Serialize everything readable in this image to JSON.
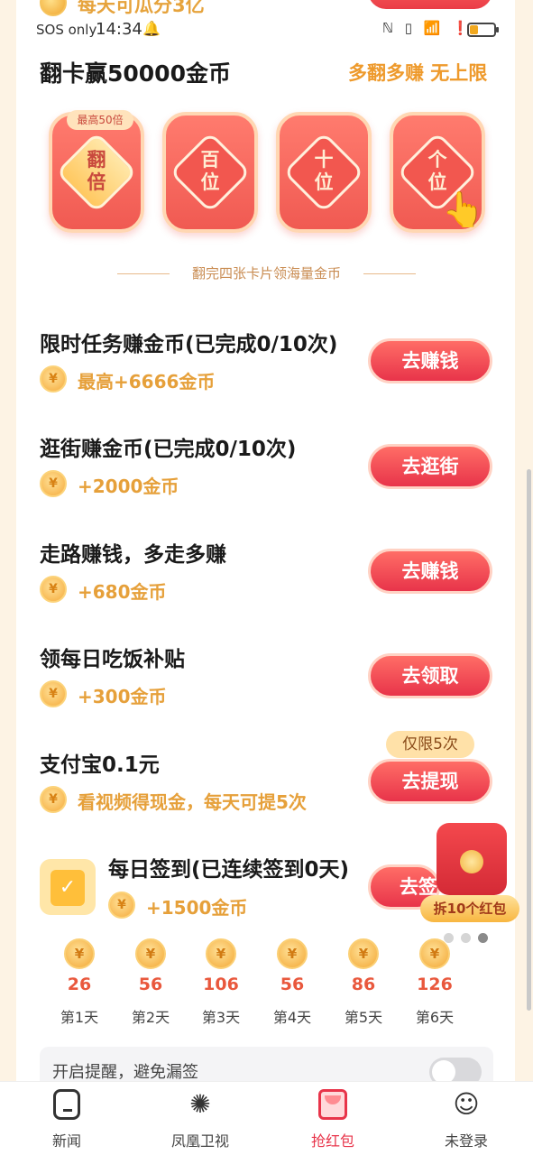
{
  "peek": {
    "text": "每天可瓜分3亿"
  },
  "status_bar": {
    "carrier": "SOS only",
    "time": "14:34",
    "bell_icon": "notification-bell-icon",
    "icons_text": "ℕ ▯ 📶 ❗"
  },
  "flip": {
    "title": "翻卡赢50000金币",
    "slogan": "多翻多赚 无上限",
    "cards": [
      {
        "label_top": "翻",
        "label_bottom": "倍",
        "badge": "最高50倍"
      },
      {
        "label_top": "百",
        "label_bottom": "位"
      },
      {
        "label_top": "十",
        "label_bottom": "位"
      },
      {
        "label_top": "个",
        "label_bottom": "位"
      }
    ],
    "note": "翻完四张卡片领海量金币"
  },
  "tasks": [
    {
      "title": "限时任务赚金币(已完成0/10次)",
      "reward": "最高+6666金币",
      "button": "去赚钱"
    },
    {
      "title": "逛街赚金币(已完成0/10次)",
      "reward": "+2000金币",
      "button": "去逛街"
    },
    {
      "title": "走路赚钱，多走多赚",
      "reward": "+680金币",
      "button": "去赚钱"
    },
    {
      "title": "领每日吃饭补贴",
      "reward": "+300金币",
      "button": "去领取"
    },
    {
      "title": "支付宝0.1元",
      "reward": "看视频得现金，每天可提5次",
      "button": "去提现",
      "badge": "仅限5次"
    }
  ],
  "checkin": {
    "title": "每日签到(已连续签到0天)",
    "reward": "+1500金币",
    "button": "去签",
    "float_label": "拆10个红包",
    "days": [
      {
        "amount": "26",
        "label": "第1天"
      },
      {
        "amount": "56",
        "label": "第2天"
      },
      {
        "amount": "106",
        "label": "第3天"
      },
      {
        "amount": "56",
        "label": "第4天"
      },
      {
        "amount": "86",
        "label": "第5天"
      },
      {
        "amount": "126",
        "label": "第6天"
      }
    ]
  },
  "reminder": {
    "text": "开启提醒，避免漏签",
    "enabled": false
  },
  "coin_symbol": "¥",
  "nav": [
    {
      "label": "新闻",
      "icon": "news-icon"
    },
    {
      "label": "凤凰卫视",
      "icon": "phoenix-tv-icon"
    },
    {
      "label": "抢红包",
      "icon": "red-envelope-icon",
      "active": true
    },
    {
      "label": "未登录",
      "icon": "user-avatar-icon"
    }
  ],
  "colors": {
    "accent_red": "#e8344a",
    "gold": "#e6a03a",
    "background": "#fdf3e4"
  }
}
